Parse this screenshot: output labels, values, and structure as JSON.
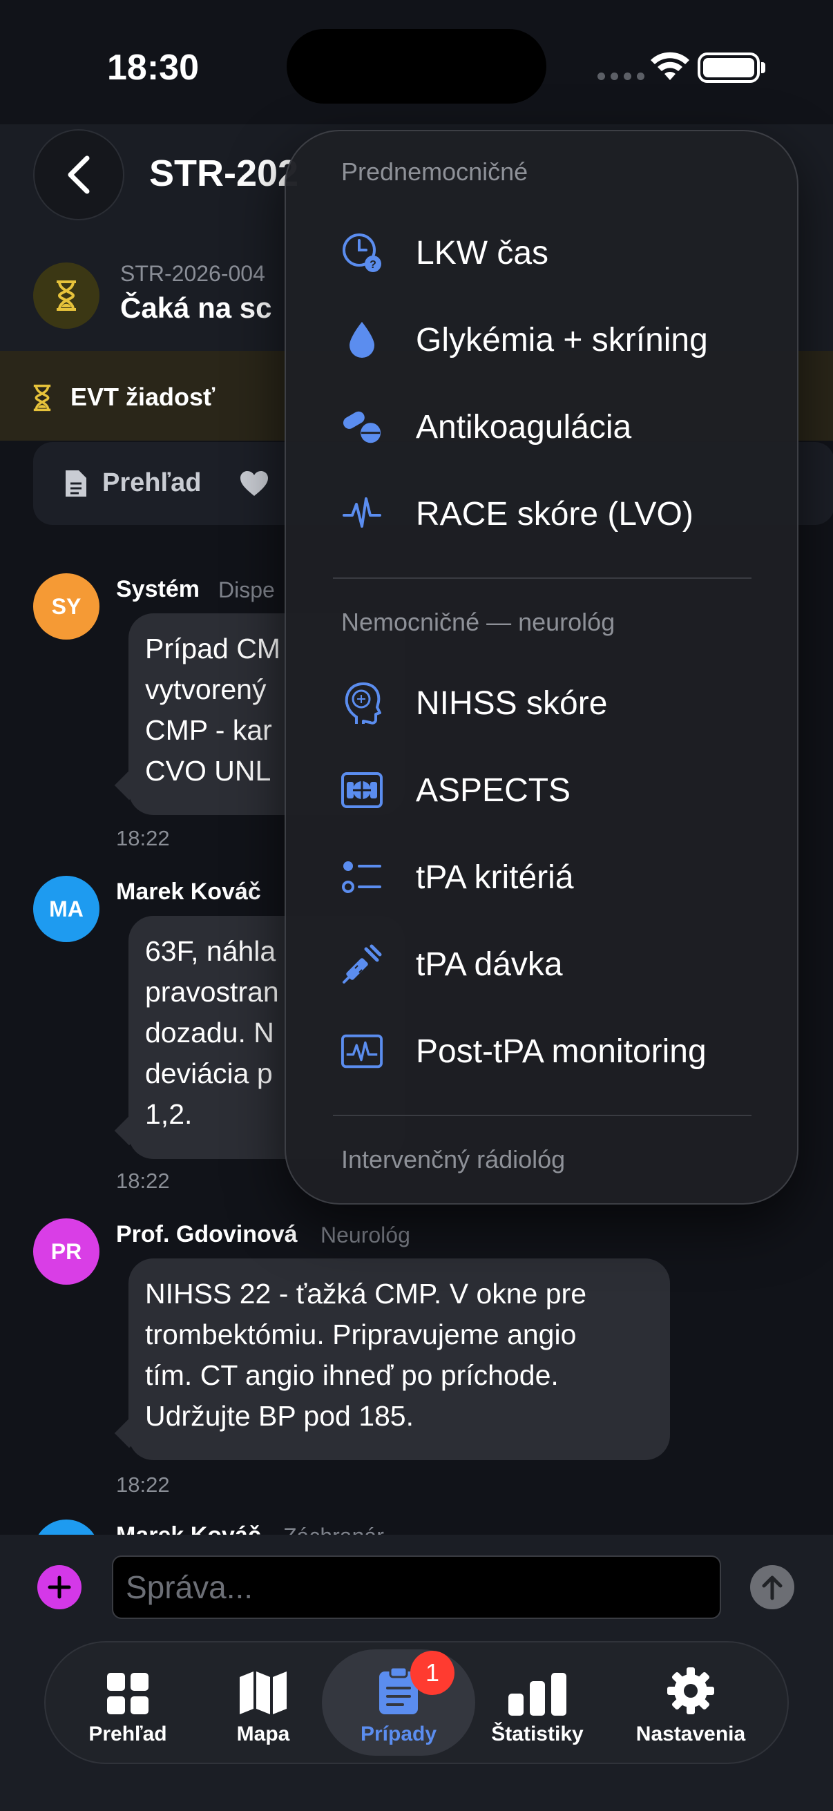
{
  "status_bar": {
    "time": "18:30"
  },
  "header": {
    "case_title": "STR-202",
    "case_sub": "STR-2026-004",
    "case_status": "Čaká na sc",
    "evt_label": "EVT žiadosť",
    "tab_overview": "Prehľad"
  },
  "messages": [
    {
      "initials": "SY",
      "sender": "Systém",
      "role": "Dispe",
      "text": [
        "Prípad CM",
        "vytvorený",
        "CMP - kar",
        "CVO UNL"
      ],
      "time": "18:22",
      "avatar_color": "#f59a35"
    },
    {
      "initials": "MA",
      "sender": "Marek Kováč",
      "role": "",
      "text": [
        "63F, náhla",
        "pravostran",
        "dozadu. N",
        "deviácia p",
        "1,2."
      ],
      "time": "18:22",
      "avatar_color": "#1e9bf0"
    },
    {
      "initials": "PR",
      "sender": "Prof. Gdovinová",
      "role": "Neurológ",
      "text": [
        "NIHSS 22 - ťažká CMP. V okne pre",
        "trombektómiu. Pripravujeme angio",
        "tím. CT angio ihneď po príchode.",
        "Udržujte BP pod 185."
      ],
      "time": "18:22",
      "avatar_color": "#d93ee6"
    },
    {
      "sender": "Marek Kováč",
      "role": "Záchranár"
    }
  ],
  "menu": {
    "sections": [
      {
        "title": "Prednemocničné",
        "items": [
          {
            "label": "LKW čas",
            "icon": "clock-question-icon"
          },
          {
            "label": "Glykémia + skríning",
            "icon": "drop-icon"
          },
          {
            "label": "Antikoagulácia",
            "icon": "pills-icon"
          },
          {
            "label": "RACE skóre (LVO)",
            "icon": "waveform-icon"
          }
        ]
      },
      {
        "title": "Nemocničné — neurológ",
        "items": [
          {
            "label": "NIHSS skóre",
            "icon": "brain-head-icon"
          },
          {
            "label": "ASPECTS",
            "icon": "scan-icon"
          },
          {
            "label": "tPA kritériá",
            "icon": "checklist-icon"
          },
          {
            "label": "tPA dávka",
            "icon": "syringe-icon"
          },
          {
            "label": "Post-tPA monitoring",
            "icon": "monitor-waveform-icon"
          }
        ]
      },
      {
        "title": "Intervenčný rádiológ",
        "items": []
      }
    ]
  },
  "composer": {
    "placeholder": "Správa..."
  },
  "tabbar": {
    "items": [
      {
        "label": "Prehľad",
        "icon": "grid-icon"
      },
      {
        "label": "Mapa",
        "icon": "map-icon"
      },
      {
        "label": "Prípady",
        "icon": "clipboard-icon",
        "badge": "1",
        "active": true
      },
      {
        "label": "Štatistiky",
        "icon": "bar-chart-icon"
      },
      {
        "label": "Nastavenia",
        "icon": "gear-icon"
      }
    ]
  },
  "colors": {
    "accent": "#5b8def",
    "warning": "#e7c33b",
    "badge": "#ff3b30",
    "plus": "#d438e8"
  }
}
